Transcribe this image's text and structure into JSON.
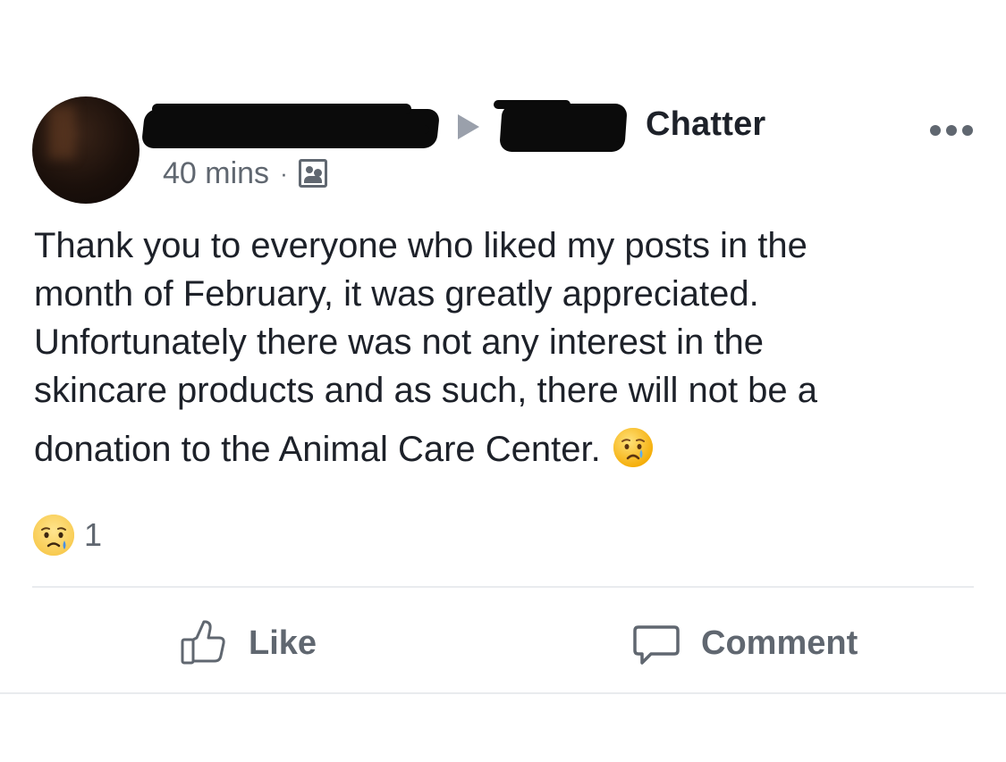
{
  "post": {
    "group_name": "Chatter",
    "timestamp": "40 mins",
    "separator": "·",
    "audience_icon": "group-icon",
    "more_icon": "more-options-icon",
    "body_lines": [
      "Thank you to everyone who liked my posts in the",
      "month of February, it was greatly appreciated.",
      "Unfortunately there was not any interest in the",
      "skincare products and as such, there will not be a",
      "donation to the Animal Care Center."
    ],
    "body_emoji": "crying-face-emoji"
  },
  "reactions": {
    "icon": "sad-reaction-icon",
    "count": "1"
  },
  "actions": {
    "like_label": "Like",
    "like_icon": "thumbs-up-icon",
    "comment_label": "Comment",
    "comment_icon": "comment-bubble-icon"
  },
  "colors": {
    "text_primary": "#1d2129",
    "text_secondary": "#606770",
    "divider": "#e9ebee",
    "arrow": "#9aa0ab",
    "reaction_yellow": "#fdd66b"
  }
}
